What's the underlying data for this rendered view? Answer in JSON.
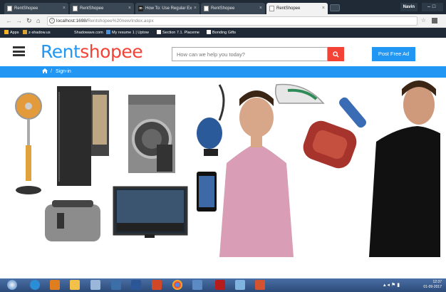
{
  "browser": {
    "tabs": [
      {
        "label": "RentShopee",
        "icon": "page-icon"
      },
      {
        "label": "RentShopee",
        "icon": "page-icon"
      },
      {
        "label": "How To: Use Regular Ex",
        "icon": "m-icon"
      },
      {
        "label": "RentShopee",
        "icon": "page-icon"
      },
      {
        "label": "RentShopee",
        "icon": "page-icon",
        "active": true
      }
    ],
    "user_label": "Navin",
    "url_host": "localhost:1698/",
    "url_path": "Rentshopee%20new/index.aspx",
    "bookmarks": [
      "Apps",
      "z-shadow.us",
      "Shadowave.com",
      "My resume 1 | Uptow",
      "Section 7.1. Placeme",
      "Bonding Gifts"
    ]
  },
  "site": {
    "logo_part1": "Rent",
    "logo_part2": "shopee",
    "search_placeholder": "How can we help you today?",
    "post_ad_label": "Post Free Ad",
    "breadcrumb_link": "Sign-in",
    "breadcrumb_sep": "/",
    "colors": {
      "primary": "#2196f3",
      "accent": "#f44336"
    }
  },
  "taskbar": {
    "time": "12:37",
    "date": "01-09-2017",
    "icons": [
      "start-icon",
      "ie-icon",
      "media-icon",
      "explorer-icon",
      "satellite-icon",
      "app1-icon",
      "app2-icon",
      "app3-icon",
      "chrome-icon",
      "network-icon",
      "filezilla-icon",
      "paint-icon",
      "powerpoint-icon"
    ]
  }
}
